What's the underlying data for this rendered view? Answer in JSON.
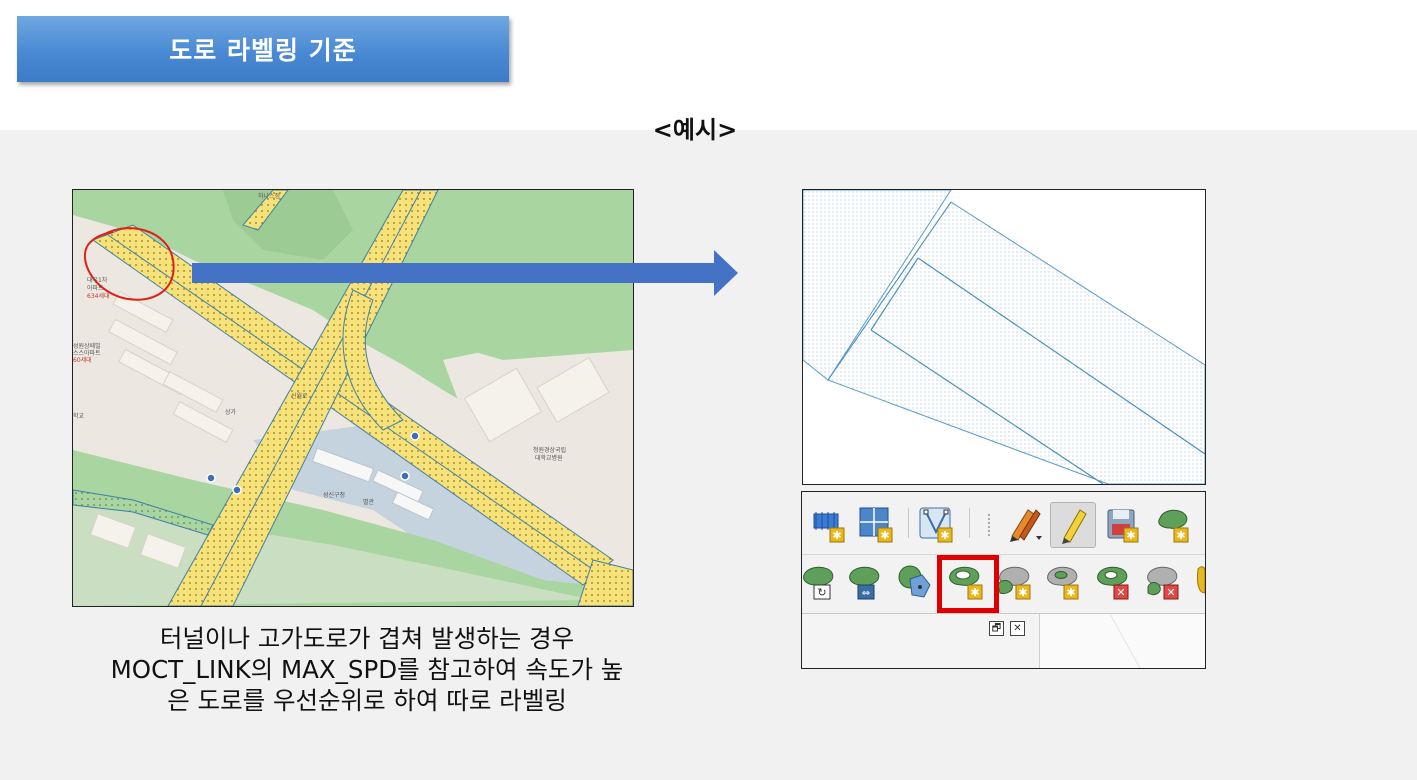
{
  "title": "도로 라벨링 기준",
  "example_label": "<예시>",
  "caption": "터널이나 고가도로가 겹쳐 발생하는 경우 MOCT_LINK의 MAX_SPD를 참고하여 속도가 높은 도로를 우선순위로 하여 따로 라벨링",
  "map_labels": {
    "park": "하나스정",
    "apt1": "대우1차",
    "apt1b": "아파트",
    "complex": "634세대",
    "apt2": "성원상떼빌",
    "apt2b": "스스아파트",
    "apt2c": "60세대",
    "road": "신월로",
    "market": "상가",
    "hospital1": "청원경상국립",
    "hospital2": "대학교병원",
    "office": "성신구청",
    "annex": "별관",
    "school": "학교"
  },
  "colors": {
    "banner": "#4a8ad4",
    "arrow": "#4472c4",
    "highlight": "#e00000",
    "road_fill": "#f7e27a",
    "park": "#a8d5a0",
    "water": "#c5d3de"
  },
  "toolbar": {
    "row1_icons": [
      "grid-snap-icon",
      "split-features-icon",
      "vertex-tool-icon",
      "edit-pencils-icon",
      "toggle-editing-icon",
      "save-edits-icon",
      "add-polygon-icon"
    ],
    "row2_icons": [
      "rotate-feature-icon",
      "move-feature-icon",
      "node-feature-icon",
      "add-ring-icon",
      "fill-ring-icon",
      "add-part-icon",
      "delete-ring-icon",
      "delete-part-icon"
    ],
    "panel_restore": "🗗",
    "panel_close": "✕"
  }
}
